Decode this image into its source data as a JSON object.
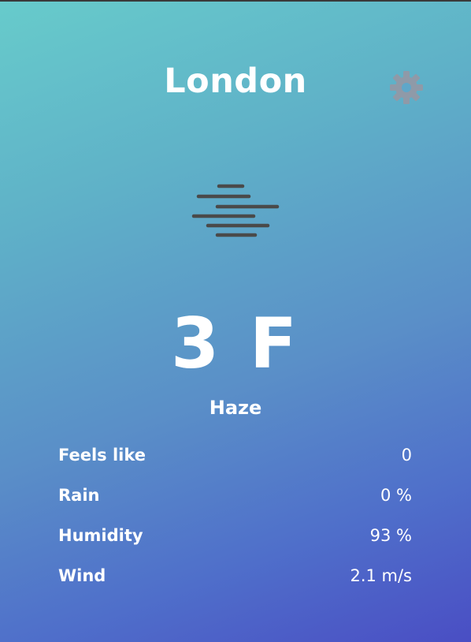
{
  "city": "London",
  "settings_icon": "gear-icon",
  "weather_icon": "haze-icon",
  "temperature": "3 F",
  "condition": "Haze",
  "details": [
    {
      "label": "Feels like",
      "value": "0"
    },
    {
      "label": "Rain",
      "value": "0 %"
    },
    {
      "label": "Humidity",
      "value": "93 %"
    },
    {
      "label": "Wind",
      "value": "2.1 m/s"
    }
  ],
  "colors": {
    "gradient_start": "#67cbcb",
    "gradient_end": "#4a4ec4",
    "text": "#ffffff",
    "gear": "#8f9aa8",
    "haze_lines": "#4a4a4a"
  }
}
